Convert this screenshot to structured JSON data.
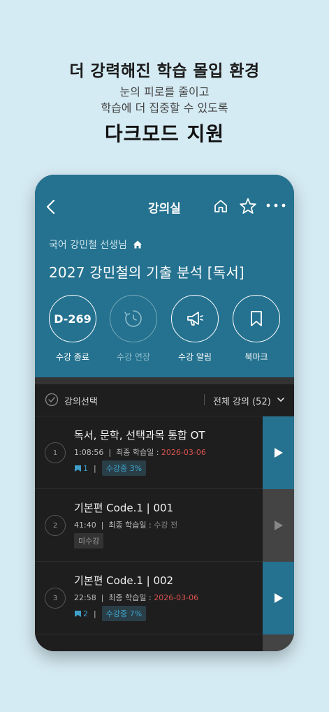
{
  "promo": {
    "headline": "더 강력해진 학습 몰입 환경",
    "sub_line1": "눈의 피로를 줄이고",
    "sub_line2": "학습에 더 집중할 수 있도록",
    "feature": "다크모드 지원"
  },
  "header": {
    "title": "강의실",
    "teacher": "국어 강민철 선생님",
    "course_title": "2027 강민철의 기출 분석 [독서]"
  },
  "actions": [
    {
      "circle_text": "D-269",
      "label": "수강 종료"
    },
    {
      "label": "수강 연장"
    },
    {
      "label": "수강 알림"
    },
    {
      "label": "북마크"
    }
  ],
  "selector": {
    "label": "강의선택",
    "all_lectures": "전체 강의 (52)"
  },
  "lessons": [
    {
      "num": "1",
      "title": "독서, 문학, 선택과목 통합 OT",
      "duration": "1:08:56",
      "last_label": "최종 학습일 : ",
      "last_date": "2026-03-06",
      "bookmarks": "1",
      "status": "수강중 3%",
      "active": true
    },
    {
      "num": "2",
      "title": "기본편 Code.1 | 001",
      "duration": "41:40",
      "last_label": "최종 학습일 : ",
      "last_date": "수강 전",
      "bookmarks": "",
      "status": "미수강",
      "active": false
    },
    {
      "num": "3",
      "title": "기본편 Code.1 | 002",
      "duration": "22:58",
      "last_label": "최종 학습일 : ",
      "last_date": "2026-03-06",
      "bookmarks": "2",
      "status": "수강중 7%",
      "active": true
    }
  ],
  "colors": {
    "hero": "#24728f",
    "accent": "#3ea6cf",
    "date_red": "#d9534f",
    "background": "#d5ebf4"
  }
}
